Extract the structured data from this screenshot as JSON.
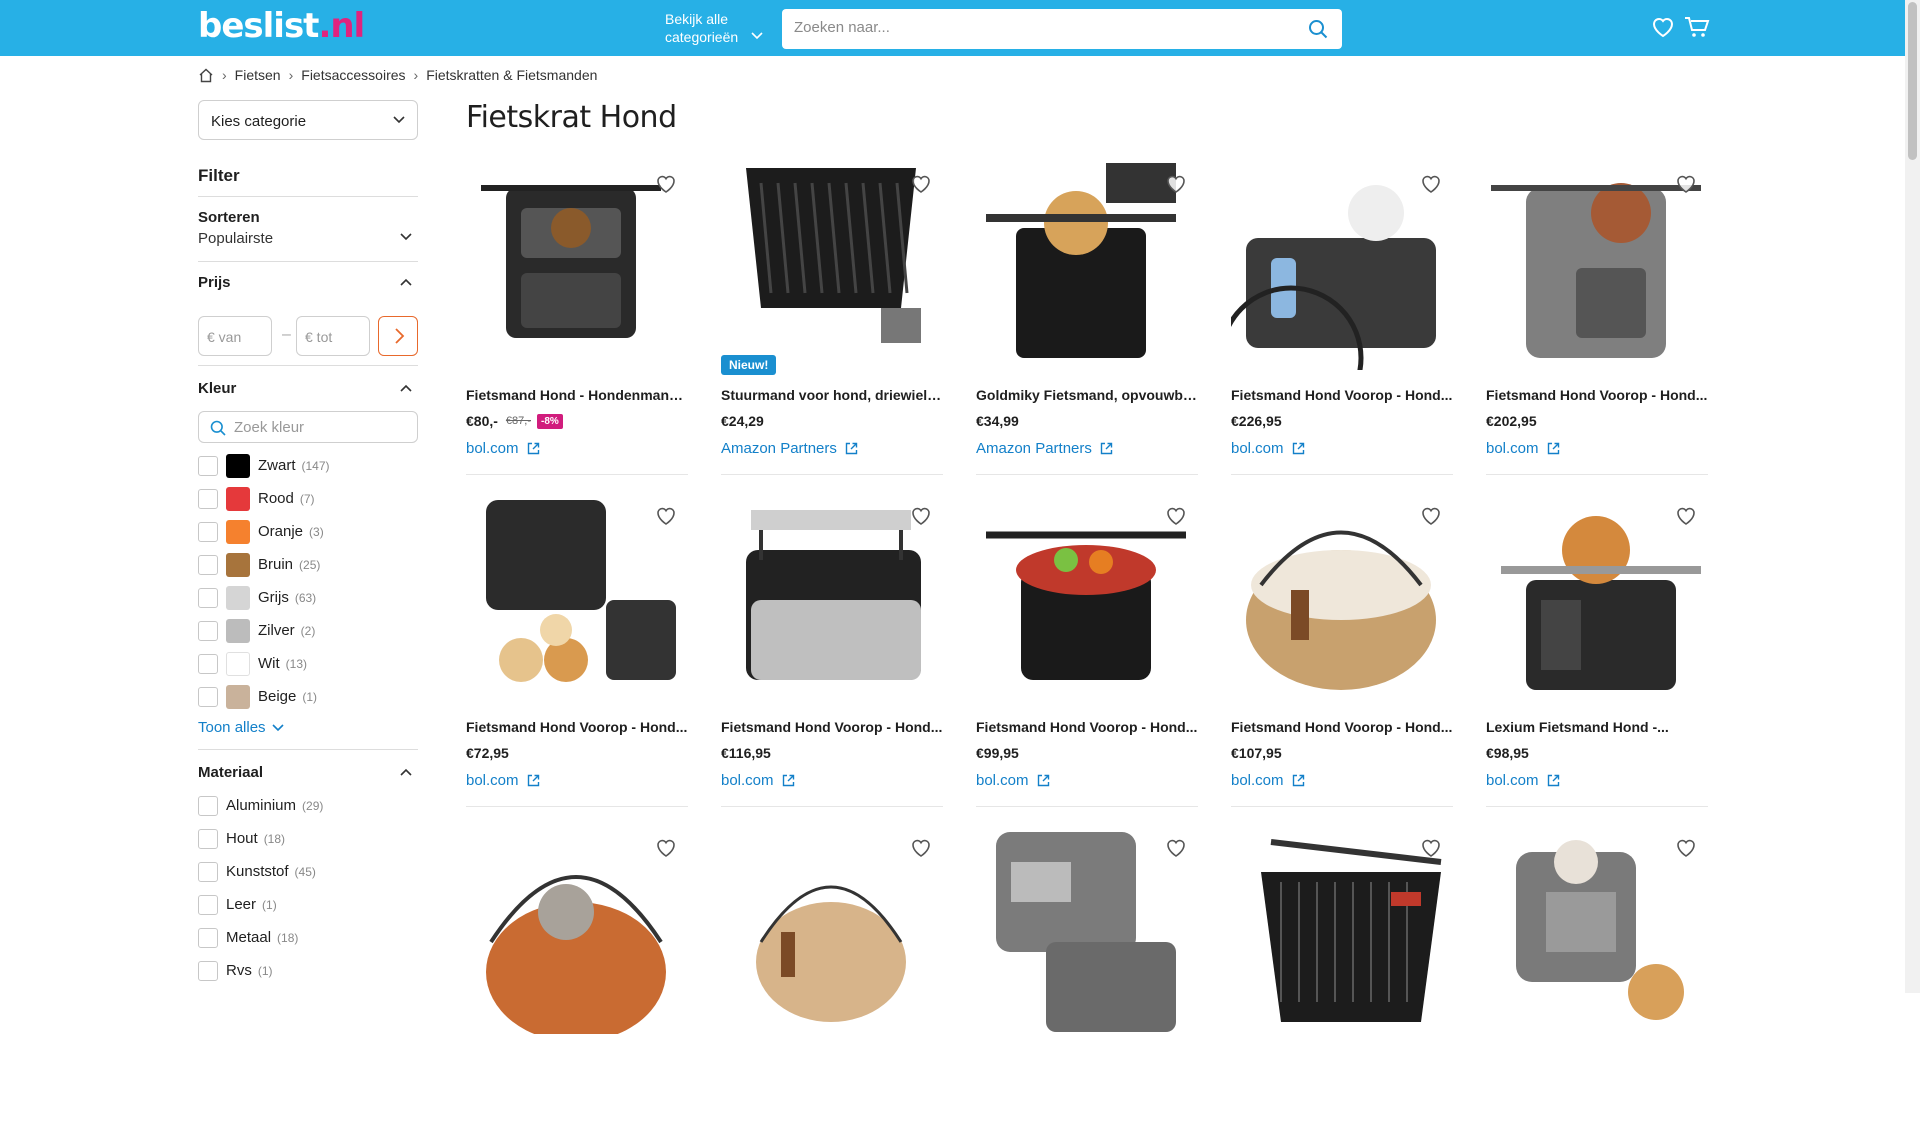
{
  "header": {
    "logo_main": "beslist",
    "logo_suffix": ".nl",
    "categories_label_line1": "Bekijk alle",
    "categories_label_line2": "categorieën",
    "search_placeholder": "Zoeken naar...",
    "accent_color": "#27b0e6",
    "brand_pink": "#e0237e"
  },
  "breadcrumb": [
    "Fietsen",
    "Fietsaccessoires",
    "Fietskratten & Fietsmanden"
  ],
  "sidebar": {
    "category_select": "Kies categorie",
    "filter_title": "Filter",
    "sort_label": "Sorteren",
    "sort_value": "Populairste",
    "price_label": "Prijs",
    "price_from_placeholder": "€  van",
    "price_to_placeholder": "€  tot",
    "price_dash": "–",
    "color_label": "Kleur",
    "color_search_placeholder": "Zoek kleur",
    "colors": [
      {
        "name": "Zwart",
        "count": "(147)",
        "hex": "#000000"
      },
      {
        "name": "Rood",
        "count": "(7)",
        "hex": "#e5393b"
      },
      {
        "name": "Oranje",
        "count": "(3)",
        "hex": "#f5812e"
      },
      {
        "name": "Bruin",
        "count": "(25)",
        "hex": "#a7743c"
      },
      {
        "name": "Grijs",
        "count": "(63)",
        "hex": "#d5d5d5"
      },
      {
        "name": "Zilver",
        "count": "(2)",
        "hex": "#bcbcbc"
      },
      {
        "name": "Wit",
        "count": "(13)",
        "hex": "#ffffff"
      },
      {
        "name": "Beige",
        "count": "(1)",
        "hex": "#c9b29b"
      }
    ],
    "show_all": "Toon alles",
    "material_label": "Materiaal",
    "materials": [
      {
        "name": "Aluminium",
        "count": "(29)"
      },
      {
        "name": "Hout",
        "count": "(18)"
      },
      {
        "name": "Kunststof",
        "count": "(45)"
      },
      {
        "name": "Leer",
        "count": "(1)"
      },
      {
        "name": "Metaal",
        "count": "(18)"
      },
      {
        "name": "Rvs",
        "count": "(1)"
      }
    ]
  },
  "page_title": "Fietskrat Hond",
  "products": [
    {
      "title": "Fietsmand Hond - Hondenmand...",
      "price": "€80,-",
      "old_price": "€87,-",
      "discount": "-8%",
      "shop": "bol.com",
      "badge": ""
    },
    {
      "title": "Stuurmand voor hond, driewieler...",
      "price": "€24,29",
      "old_price": "",
      "discount": "",
      "shop": "Amazon Partners",
      "badge": "Nieuw!"
    },
    {
      "title": "Goldmiky Fietsmand, opvouwba...",
      "price": "€34,99",
      "old_price": "",
      "discount": "",
      "shop": "Amazon Partners",
      "badge": ""
    },
    {
      "title": "Fietsmand Hond Voorop - Hond...",
      "price": "€226,95",
      "old_price": "",
      "discount": "",
      "shop": "bol.com",
      "badge": ""
    },
    {
      "title": "Fietsmand Hond Voorop - Hond...",
      "price": "€202,95",
      "old_price": "",
      "discount": "",
      "shop": "bol.com",
      "badge": ""
    },
    {
      "title": "Fietsmand Hond Voorop - Hond...",
      "price": "€72,95",
      "old_price": "",
      "discount": "",
      "shop": "bol.com",
      "badge": ""
    },
    {
      "title": "Fietsmand Hond Voorop - Hond...",
      "price": "€116,95",
      "old_price": "",
      "discount": "",
      "shop": "bol.com",
      "badge": ""
    },
    {
      "title": "Fietsmand Hond Voorop - Hond...",
      "price": "€99,95",
      "old_price": "",
      "discount": "",
      "shop": "bol.com",
      "badge": ""
    },
    {
      "title": "Fietsmand Hond Voorop - Hond...",
      "price": "€107,95",
      "old_price": "",
      "discount": "",
      "shop": "bol.com",
      "badge": ""
    },
    {
      "title": "Lexium Fietsmand Hond -...",
      "price": "€98,95",
      "old_price": "",
      "discount": "",
      "shop": "bol.com",
      "badge": ""
    },
    {
      "title": "",
      "price": "",
      "old_price": "",
      "discount": "",
      "shop": "",
      "badge": ""
    },
    {
      "title": "",
      "price": "",
      "old_price": "",
      "discount": "",
      "shop": "",
      "badge": ""
    },
    {
      "title": "",
      "price": "",
      "old_price": "",
      "discount": "",
      "shop": "",
      "badge": ""
    },
    {
      "title": "",
      "price": "",
      "old_price": "",
      "discount": "",
      "shop": "",
      "badge": ""
    },
    {
      "title": "",
      "price": "",
      "old_price": "",
      "discount": "",
      "shop": "",
      "badge": ""
    }
  ]
}
